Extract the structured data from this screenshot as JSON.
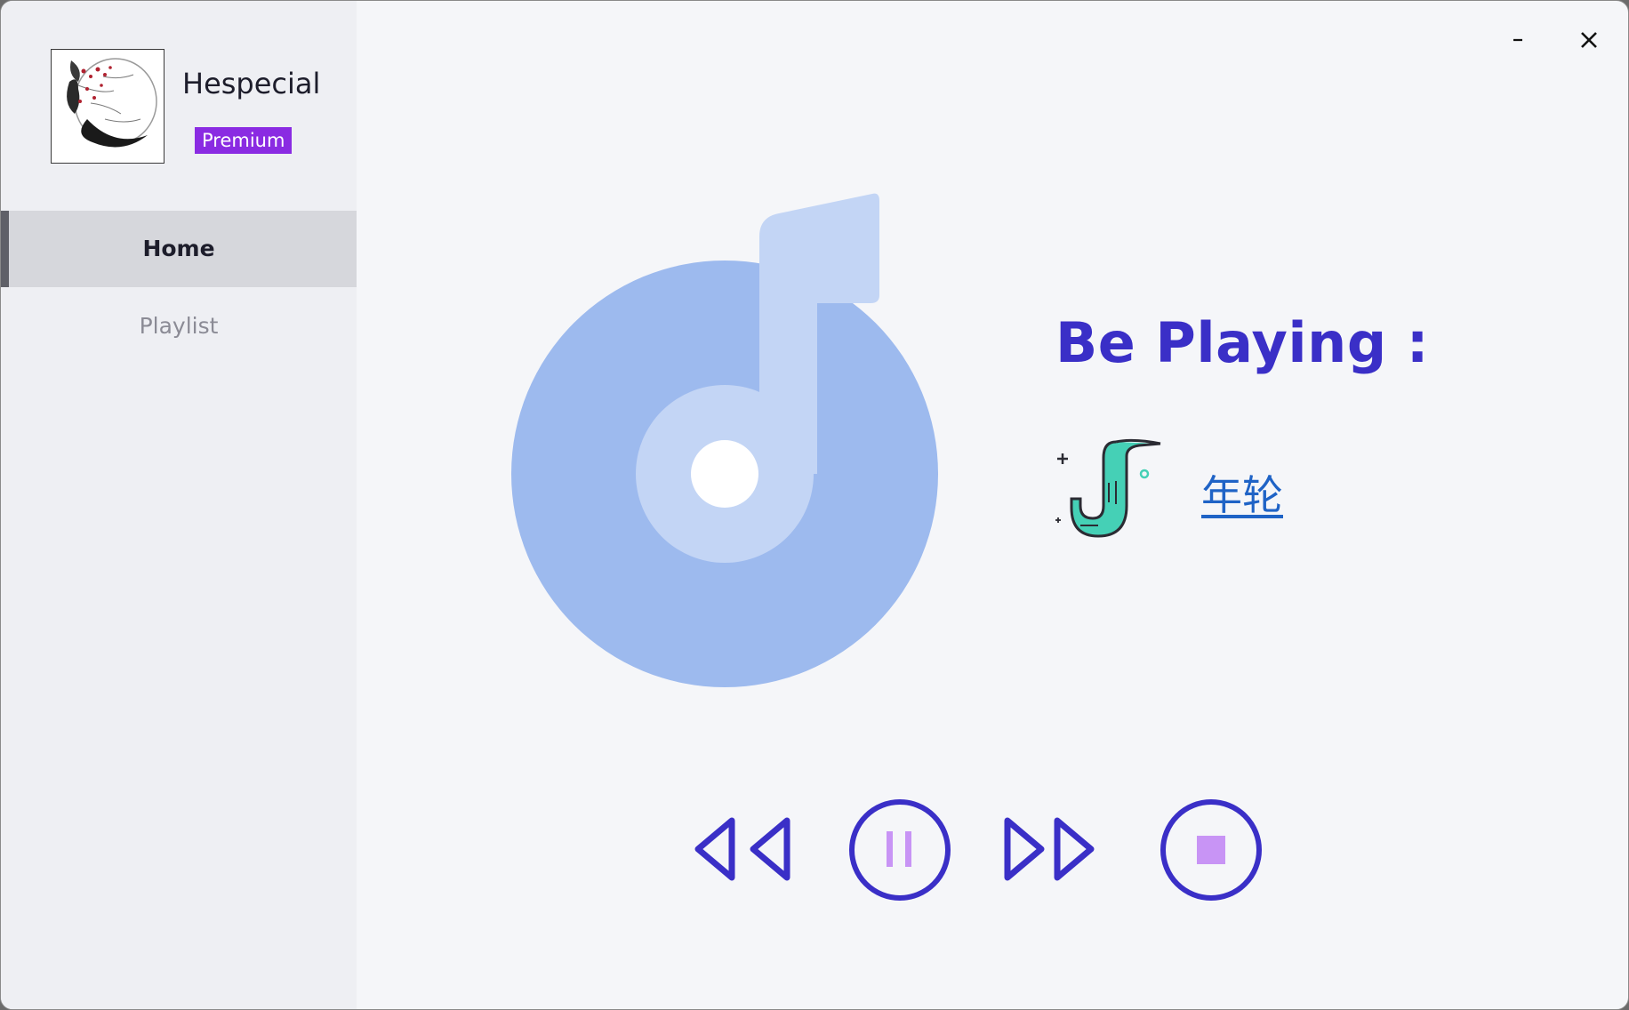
{
  "user": {
    "name": "Hespecial",
    "badge": "Premium"
  },
  "nav": {
    "items": [
      {
        "label": "Home",
        "active": true
      },
      {
        "label": "Playlist",
        "active": false
      }
    ]
  },
  "window_controls": {
    "minimize_icon": "minimize-icon",
    "close_icon": "close-icon"
  },
  "now_playing": {
    "heading": "Be Playing :",
    "song": "年轮"
  },
  "controls": {
    "icons": [
      "rewind-icon",
      "pause-icon",
      "fast-forward-icon",
      "stop-icon"
    ]
  },
  "colors": {
    "accent": "#3a2fc7",
    "badge": "#8a2be2",
    "link": "#1f63c6",
    "disc": "#9dbaee",
    "note": "#c3d5f5",
    "control_inner": "#c894f5",
    "sax_teal": "#45d0b6"
  }
}
